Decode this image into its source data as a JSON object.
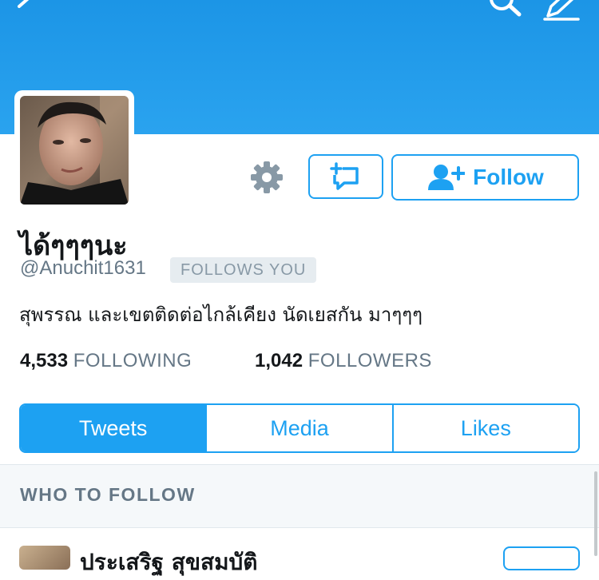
{
  "profile": {
    "display_name": "ได้ๆๆๆนะ",
    "handle": "@Anuchit1631",
    "follows_you": "FOLLOWS YOU",
    "bio": "สุพรรณ และเขตติดต่อไกล้เคียง นัดเยสกัน มาๆๆๆ"
  },
  "actions": {
    "follow_label": "Follow"
  },
  "stats": {
    "following_count": "4,533",
    "following_label": "FOLLOWING",
    "followers_count": "1,042",
    "followers_label": "FOLLOWERS"
  },
  "tabs": [
    {
      "label": "Tweets",
      "active": true
    },
    {
      "label": "Media",
      "active": false
    },
    {
      "label": "Likes",
      "active": false
    }
  ],
  "who_to_follow": {
    "title": "WHO TO FOLLOW",
    "suggestions": [
      {
        "name": "ประเสริฐ สุขสมบัติ"
      }
    ]
  },
  "colors": {
    "accent": "#1da1f2",
    "header": "#1c95e6",
    "muted": "#657786"
  },
  "icons": [
    "back-icon",
    "search-icon",
    "compose-icon",
    "gear-icon",
    "direct-message-icon",
    "add-user-icon"
  ]
}
